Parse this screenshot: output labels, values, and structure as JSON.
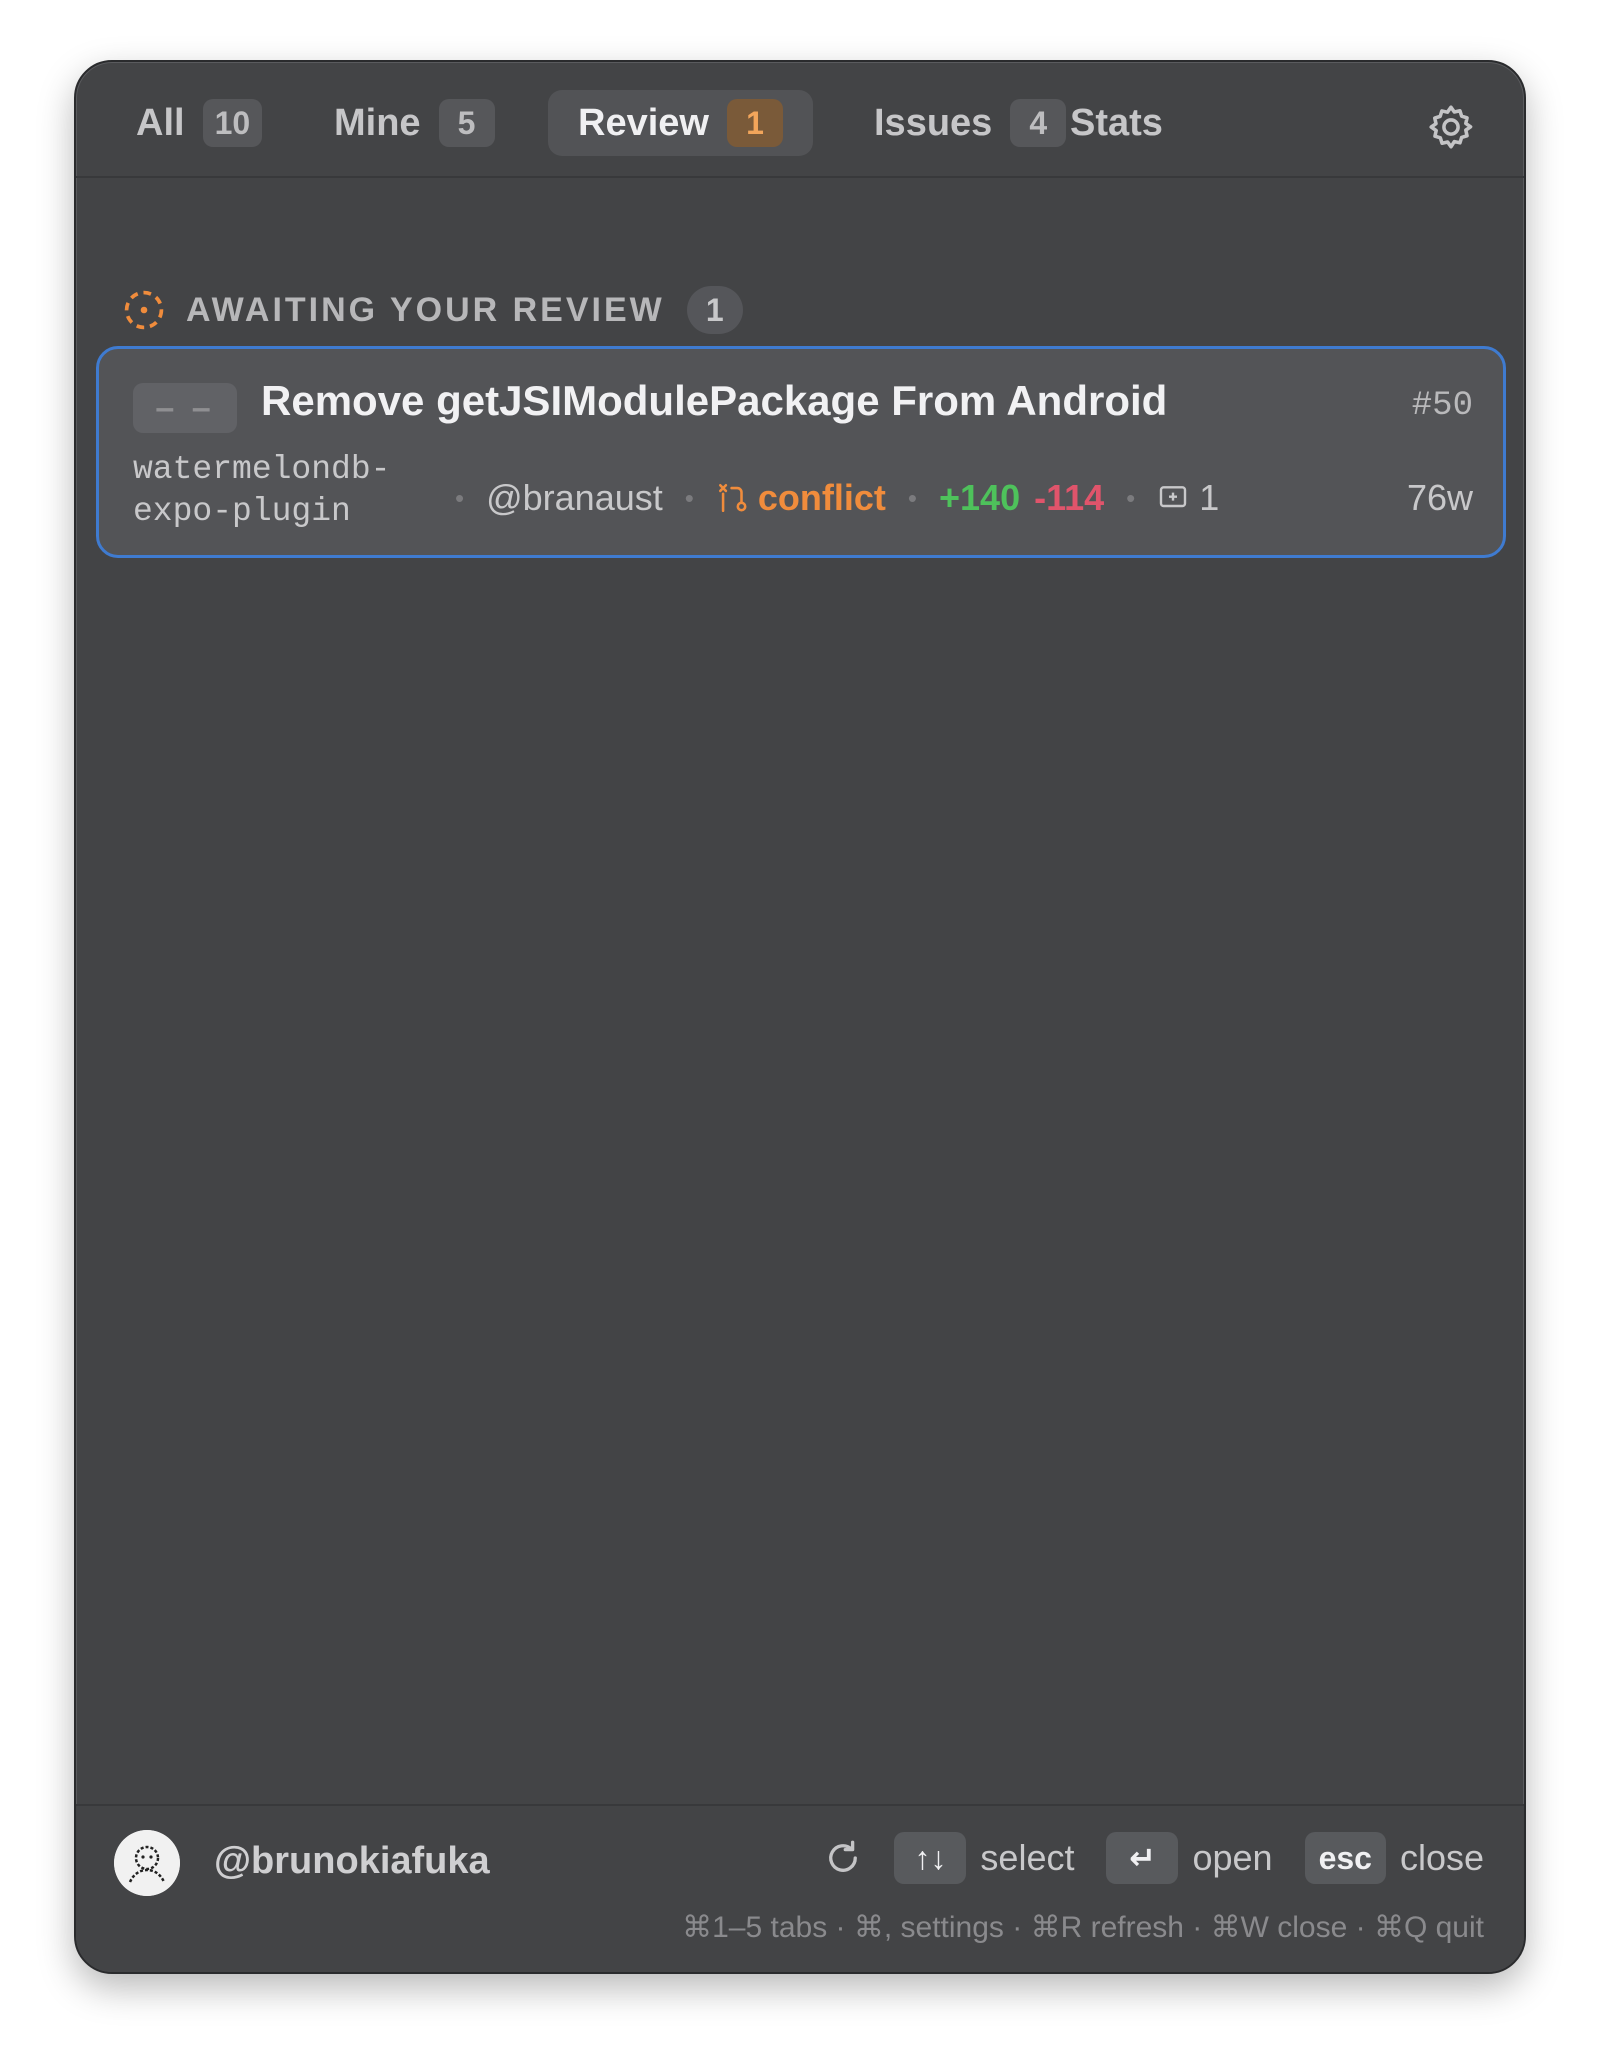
{
  "tabs": [
    {
      "label": "All",
      "count": "10"
    },
    {
      "label": "Mine",
      "count": "5"
    },
    {
      "label": "Review",
      "count": "1"
    },
    {
      "label": "Issues",
      "count": "4"
    },
    {
      "label": "Stats",
      "count": ""
    }
  ],
  "active_tab": "Review",
  "section": {
    "title": "AWAITING YOUR REVIEW",
    "count": "1"
  },
  "pr": {
    "status_chip": "– –",
    "title": "Remove getJSIModulePackage From Android",
    "number": "#50",
    "repo": "watermelondb-expo-plugin",
    "author": "@branaust",
    "state": "conflict",
    "additions": "+140",
    "deletions": "-114",
    "comments": "1",
    "age": "76w"
  },
  "footer": {
    "username": "@brunokiafuka",
    "shortcuts": [
      {
        "key": "↑↓",
        "label": "select"
      },
      {
        "key": "↵",
        "label": "open"
      },
      {
        "key": "esc",
        "label": "close"
      }
    ],
    "hints": "⌘1–5 tabs · ⌘, settings · ⌘R refresh · ⌘W close · ⌘Q quit"
  },
  "colors": {
    "accent_orange": "#f08c3c",
    "selection_blue": "#3f7bd0",
    "additions_green": "#4ec25b",
    "deletions_red": "#e0546b"
  },
  "icons": {
    "settings": "gear-icon",
    "section": "dashed-circle-icon",
    "conflict": "merge-conflict-icon",
    "comments": "comment-icon",
    "refresh": "refresh-icon"
  }
}
